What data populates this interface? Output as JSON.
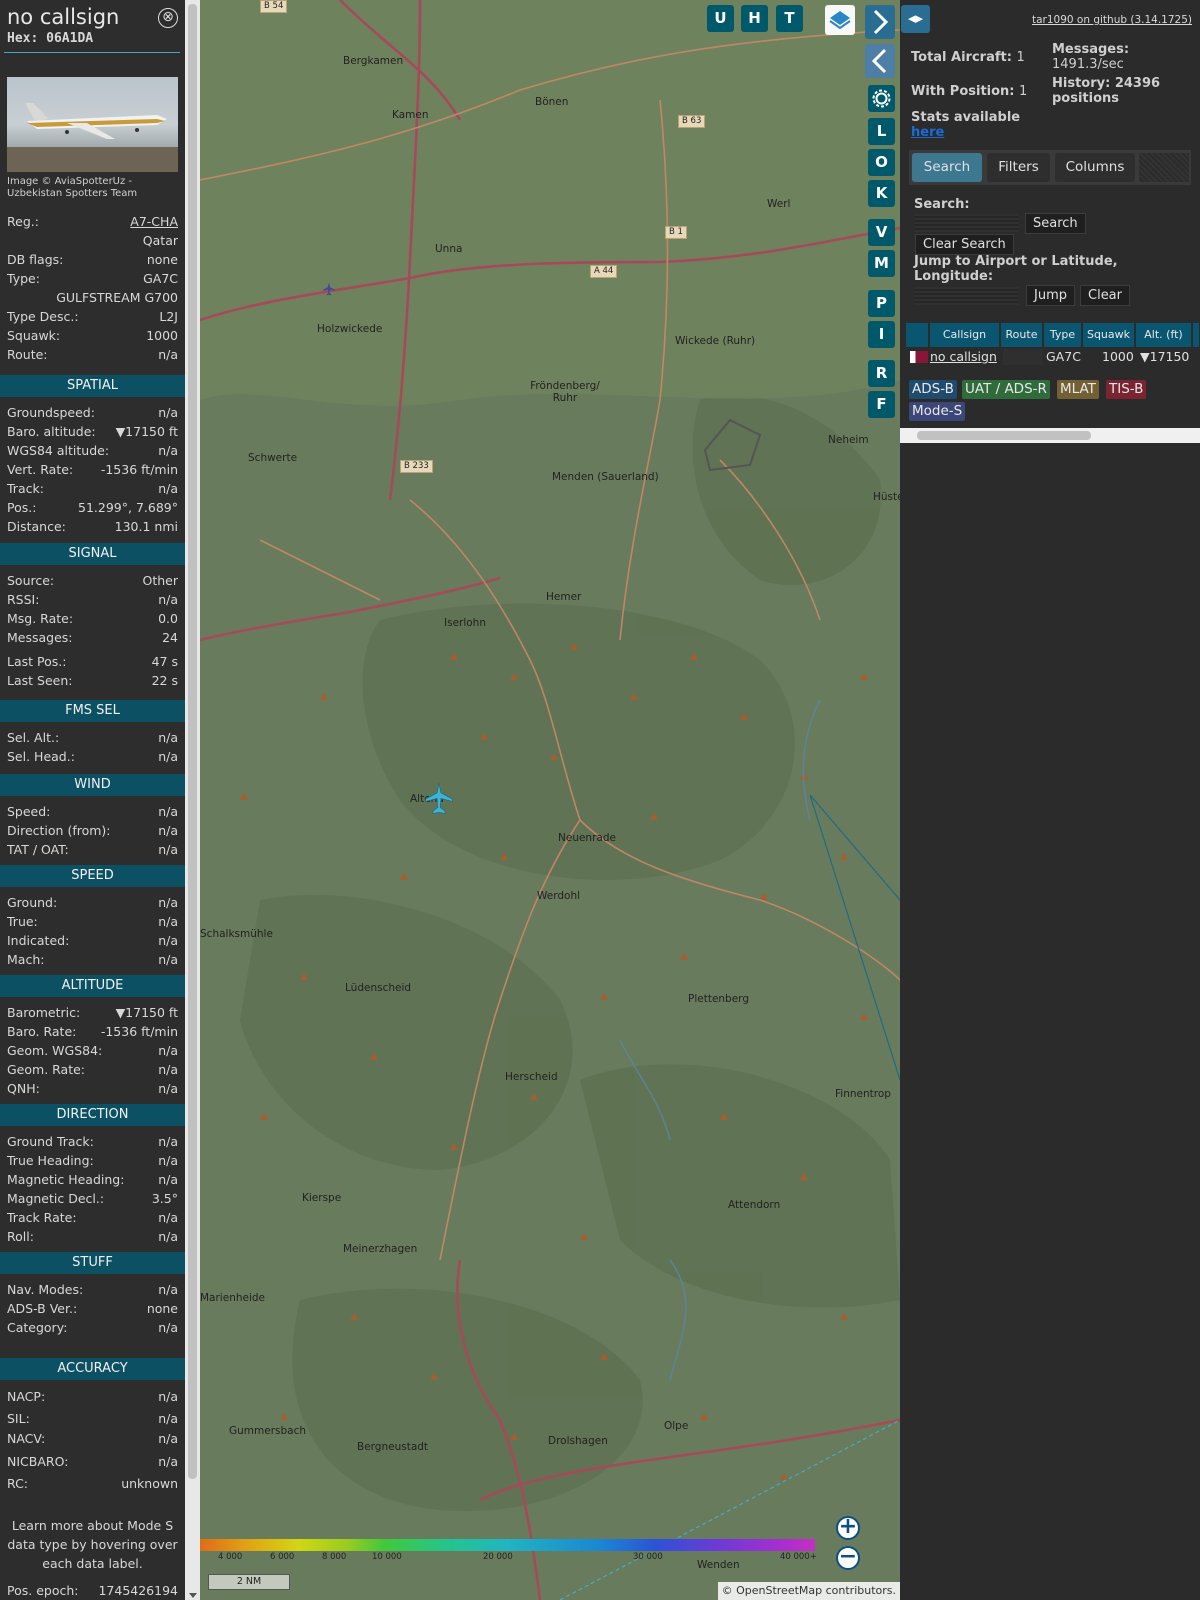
{
  "info": {
    "callsign": "no callsign",
    "hex": "Hex: 06A1DA",
    "close_glyph": "⊗",
    "photo_credit": "Image © AviaSpotterUz - Uzbekistan Spotters Team",
    "basic": [
      {
        "label": "Reg.:",
        "value": "A7-CHA"
      },
      {
        "label": "",
        "value": "Qatar"
      },
      {
        "label": "DB flags:",
        "value": "none"
      },
      {
        "label": "Type:",
        "value": "GA7C"
      },
      {
        "label": "",
        "value": "GULFSTREAM G700"
      },
      {
        "label": "Type Desc.:",
        "value": "L2J"
      },
      {
        "label": "Squawk:",
        "value": "1000"
      },
      {
        "label": "Route:",
        "value": "n/a"
      }
    ],
    "spatial": {
      "title": "SPATIAL",
      "rows": [
        {
          "label": "Groundspeed:",
          "value": "n/a"
        },
        {
          "label": "Baro. altitude:",
          "value": "▼17150 ft"
        },
        {
          "label": "WGS84 altitude:",
          "value": "n/a"
        },
        {
          "label": "Vert. Rate:",
          "value": "-1536 ft/min"
        },
        {
          "label": "Track:",
          "value": "n/a"
        },
        {
          "label": "Pos.:",
          "value": "51.299°, 7.689°"
        },
        {
          "label": "Distance:",
          "value": "130.1 nmi"
        }
      ]
    },
    "signal": {
      "title": "SIGNAL",
      "rows": [
        {
          "label": "Source:",
          "value": "Other"
        },
        {
          "label": "RSSI:",
          "value": "n/a"
        },
        {
          "label": "Msg. Rate:",
          "value": "0.0"
        },
        {
          "label": "Messages:",
          "value": "24"
        },
        {
          "label": "Last Pos.:",
          "value": "47 s"
        },
        {
          "label": "Last Seen:",
          "value": "22 s"
        }
      ]
    },
    "fms": {
      "title": "FMS SEL",
      "rows": [
        {
          "label": "Sel. Alt.:",
          "value": "n/a"
        },
        {
          "label": "Sel. Head.:",
          "value": "n/a"
        }
      ]
    },
    "wind": {
      "title": "WIND",
      "rows": [
        {
          "label": "Speed:",
          "value": "n/a"
        },
        {
          "label": "Direction (from):",
          "value": "n/a"
        },
        {
          "label": "TAT / OAT:",
          "value": "n/a"
        }
      ]
    },
    "speed": {
      "title": "SPEED",
      "rows": [
        {
          "label": "Ground:",
          "value": "n/a"
        },
        {
          "label": "True:",
          "value": "n/a"
        },
        {
          "label": "Indicated:",
          "value": "n/a"
        },
        {
          "label": "Mach:",
          "value": "n/a"
        }
      ]
    },
    "altitude": {
      "title": "ALTITUDE",
      "rows": [
        {
          "label": "Barometric:",
          "value": "▼17150 ft"
        },
        {
          "label": "Baro. Rate:",
          "value": "-1536 ft/min"
        },
        {
          "label": "Geom. WGS84:",
          "value": "n/a"
        },
        {
          "label": "Geom. Rate:",
          "value": "n/a"
        },
        {
          "label": "QNH:",
          "value": "n/a"
        }
      ]
    },
    "direction": {
      "title": "DIRECTION",
      "rows": [
        {
          "label": "Ground Track:",
          "value": "n/a"
        },
        {
          "label": "True Heading:",
          "value": "n/a"
        },
        {
          "label": "Magnetic Heading:",
          "value": "n/a"
        },
        {
          "label": "Magnetic Decl.:",
          "value": "3.5°"
        },
        {
          "label": "Track Rate:",
          "value": "n/a"
        },
        {
          "label": "Roll:",
          "value": "n/a"
        }
      ]
    },
    "stuff": {
      "title": "STUFF",
      "rows": [
        {
          "label": "Nav. Modes:",
          "value": "n/a"
        },
        {
          "label": "ADS-B Ver.:",
          "value": "none"
        },
        {
          "label": "Category:",
          "value": "n/a"
        }
      ]
    },
    "accuracy": {
      "title": "ACCURACY",
      "rows": [
        {
          "label": "NACP:",
          "value": "n/a"
        },
        {
          "label": "SIL:",
          "value": "n/a"
        },
        {
          "label": "NACV:",
          "value": "n/a"
        },
        {
          "label": "NICBARO:",
          "value": "n/a"
        },
        {
          "label": "RC:",
          "value": "unknown"
        }
      ]
    },
    "learn_more": "Learn more about Mode S data type by hovering over each data label.",
    "pos_epoch": {
      "label": "Pos. epoch:",
      "value": "1745426194"
    }
  },
  "map": {
    "top_buttons": [
      "U",
      "H",
      "T"
    ],
    "side_buttons": [
      "L",
      "O",
      "K",
      "V",
      "M",
      "P",
      "I",
      "R",
      "F"
    ],
    "settings_icon": "gear-icon",
    "layers_icon": "layers-icon",
    "towns": [
      "Bergkamen",
      "Kamen",
      "Bönen",
      "Werl",
      "Unna",
      "Holzwickede",
      "Wickede (Ruhr)",
      "Fröndenberg/ Ruhr",
      "Schwerte",
      "Menden (Sauerland)",
      "Neheim",
      "Hemer",
      "Iserlohn",
      "Altena",
      "Neuenrade",
      "Werdohl",
      "Lüdenscheid",
      "Plettenberg",
      "Herscheid",
      "Finnentrop",
      "Kierspe",
      "Attendorn",
      "Meinerzhagen",
      "Gummersbach",
      "Bergneustadt",
      "Drolshagen",
      "Olpe",
      "Wenden",
      "Schalksmühle",
      "Marienheide",
      "Hüsten"
    ],
    "road_badges": [
      "B 54",
      "B 63",
      "B 1",
      "A 44",
      "B 233"
    ],
    "altitude_ticks": [
      "4 000",
      "6 000",
      "8 000",
      "10 000",
      "20 000",
      "30 000",
      "40 000+"
    ],
    "scale": "2 NM",
    "attribution": "© OpenStreetMap contributors."
  },
  "side": {
    "github_link": "tar1090 on github (3.14.1725)",
    "stats": {
      "total_aircraft_label": "Total Aircraft:",
      "total_aircraft": "1",
      "messages_label": "Messages:",
      "messages_rate": "1491.3/sec",
      "with_position_label": "With Position:",
      "with_position": "1",
      "history_label": "History: 24396 positions",
      "stats_available": "Stats available",
      "here": "here"
    },
    "tabs": [
      "Search",
      "Filters",
      "Columns"
    ],
    "search": {
      "search_label": "Search:",
      "search_button": "Search",
      "clear_search_button": "Clear Search",
      "jump_label": "Jump to Airport or Latitude, Longitude:",
      "jump_button": "Jump",
      "clear_button": "Clear"
    },
    "table": {
      "columns": [
        "Callsign",
        "Route",
        "Type",
        "Squawk",
        "Alt. (ft)"
      ],
      "rows": [
        {
          "callsign": "no callsign",
          "route": "",
          "type": "GA7C",
          "squawk": "1000",
          "alt": "▼17150"
        }
      ]
    },
    "source_tags": [
      {
        "label": "ADS-B",
        "color": "#1f4b6e"
      },
      {
        "label": "UAT / ADS-R",
        "color": "#2f6b3b"
      },
      {
        "label": "MLAT",
        "color": "#735f34"
      },
      {
        "label": "TIS-B",
        "color": "#7a2331"
      },
      {
        "label": "Mode-S",
        "color": "#3b4679"
      }
    ]
  },
  "colors": {
    "section_bar": "#0c5064",
    "accent": "#00596b",
    "aircraft": "#3fb3d3"
  }
}
